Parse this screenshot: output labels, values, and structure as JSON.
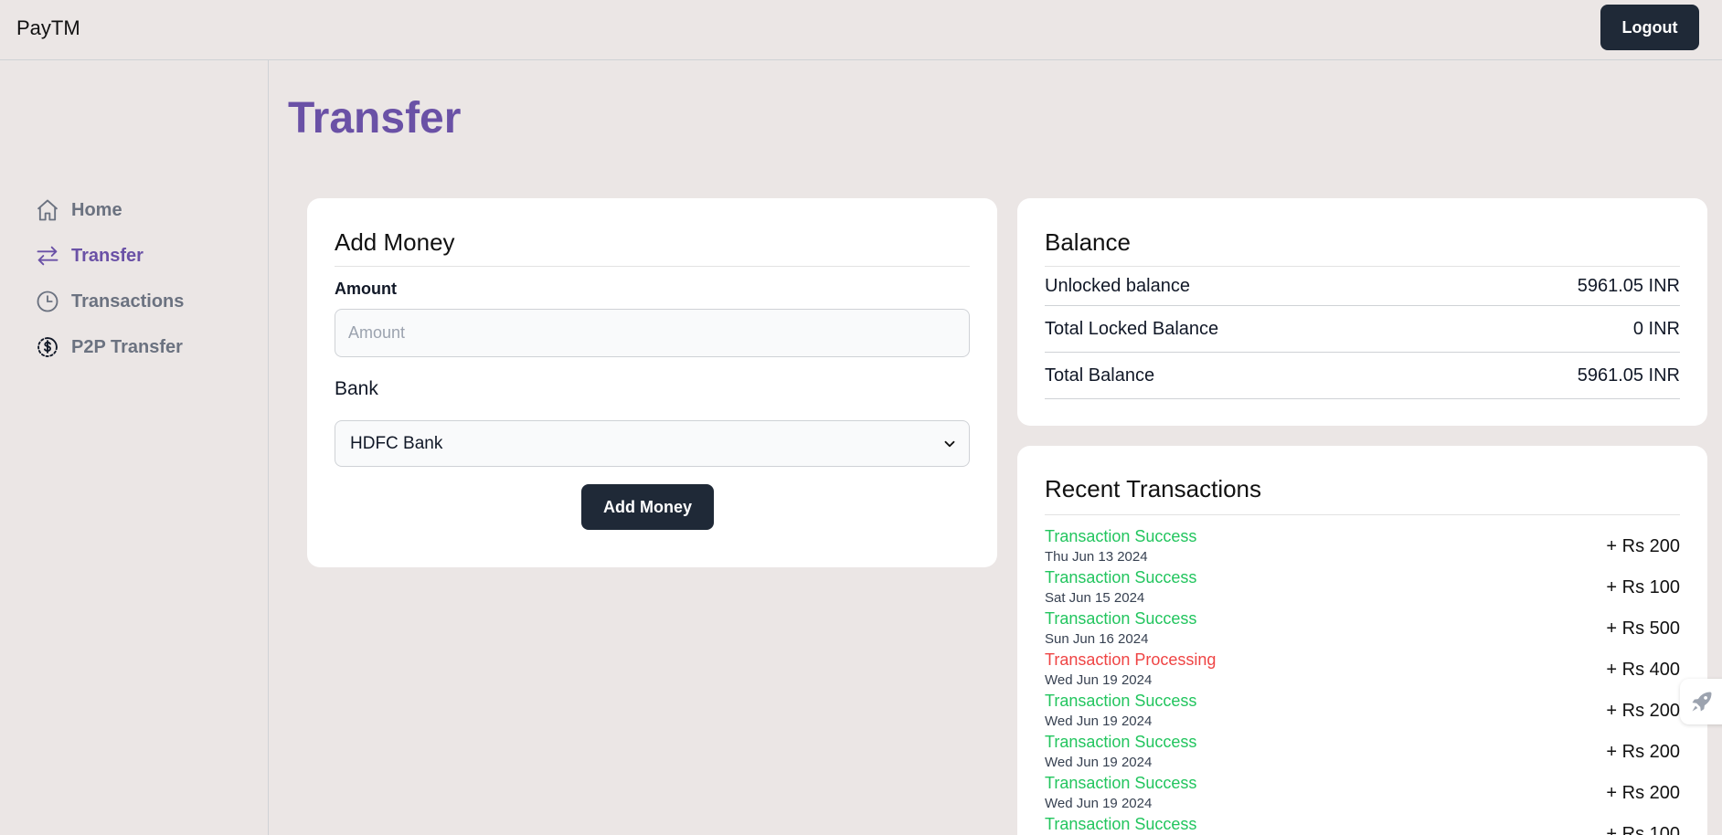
{
  "header": {
    "brand": "PayTM",
    "logout_label": "Logout"
  },
  "sidebar": {
    "items": [
      {
        "label": "Home",
        "icon": "home-icon"
      },
      {
        "label": "Transfer",
        "icon": "transfer-arrows-icon",
        "active": true
      },
      {
        "label": "Transactions",
        "icon": "clock-icon"
      },
      {
        "label": "P2P Transfer",
        "icon": "dollar-cycle-icon"
      }
    ]
  },
  "page": {
    "title": "Transfer"
  },
  "add_money": {
    "title": "Add Money",
    "amount_label": "Amount",
    "amount_placeholder": "Amount",
    "amount_value": "",
    "bank_label": "Bank",
    "bank_selected": "HDFC Bank",
    "button_label": "Add Money"
  },
  "balance": {
    "title": "Balance",
    "rows": [
      {
        "label": "Unlocked balance",
        "value": "5961.05 INR"
      },
      {
        "label": "Total Locked Balance",
        "value": "0 INR"
      },
      {
        "label": "Total Balance",
        "value": "5961.05 INR"
      }
    ]
  },
  "recent": {
    "title": "Recent Transactions",
    "items": [
      {
        "status": "Transaction Success",
        "state": "success",
        "date": "Thu Jun 13 2024",
        "amount": "+ Rs 200"
      },
      {
        "status": "Transaction Success",
        "state": "success",
        "date": "Sat Jun 15 2024",
        "amount": "+ Rs 100"
      },
      {
        "status": "Transaction Success",
        "state": "success",
        "date": "Sun Jun 16 2024",
        "amount": "+ Rs 500"
      },
      {
        "status": "Transaction Processing",
        "state": "processing",
        "date": "Wed Jun 19 2024",
        "amount": "+ Rs 400"
      },
      {
        "status": "Transaction Success",
        "state": "success",
        "date": "Wed Jun 19 2024",
        "amount": "+ Rs 200"
      },
      {
        "status": "Transaction Success",
        "state": "success",
        "date": "Wed Jun 19 2024",
        "amount": "+ Rs 200"
      },
      {
        "status": "Transaction Success",
        "state": "success",
        "date": "Wed Jun 19 2024",
        "amount": "+ Rs 200"
      },
      {
        "status": "Transaction Success",
        "state": "success",
        "date": "",
        "amount": "+ Rs 100"
      }
    ]
  },
  "colors": {
    "accent": "#6a51a6",
    "success": "#22c55e",
    "processing": "#ef4444",
    "dark_button": "#1f2937",
    "background": "#ebe6e5"
  },
  "floating_button": {
    "icon": "rocket-icon"
  }
}
